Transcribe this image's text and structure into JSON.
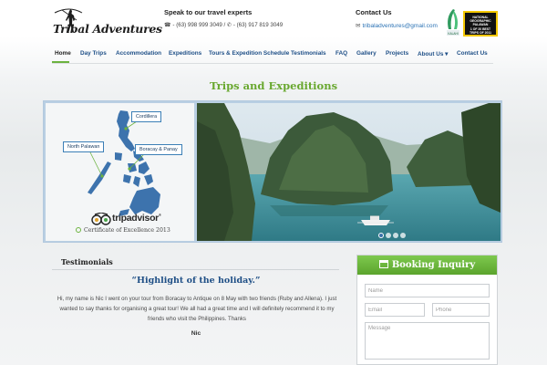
{
  "header": {
    "logo_text": "Tribal Adventures",
    "speak_title": "Speak to our travel experts",
    "phones": "☎ - (63) 998 999 3049 / ✆ - (63) 917 819 3049",
    "contact_title": "Contact Us",
    "email": "tribaladventures@gmail.com",
    "email_icon": "envelope-icon",
    "award_leaf_icon": "laurel-award-icon",
    "natgeo_badge": [
      "NATIONAL",
      "GEOGRAPHIC",
      "PALAWAN",
      "1 OF 20 BEST",
      "TRIPS OF 2011"
    ]
  },
  "nav": {
    "items": [
      {
        "label": "Home",
        "active": true
      },
      {
        "label": "Day Trips"
      },
      {
        "label": "Accommodation"
      },
      {
        "label": "Expeditions"
      },
      {
        "label": "Tours & Expedition Schedule"
      },
      {
        "label": "Testimonials"
      },
      {
        "label": "FAQ"
      },
      {
        "label": "Gallery"
      },
      {
        "label": "Projects"
      },
      {
        "label": "About Us ▾"
      },
      {
        "label": "Contact Us"
      }
    ]
  },
  "section_title": "Trips and Expeditions",
  "hero": {
    "map_labels": {
      "cordillera": "Cordillera",
      "north_palawan": "North Palawan",
      "boracay": "Boracay & Panay"
    },
    "tripadvisor_text": "tripadvisor",
    "certificate": "Certificate of Excellence 2013",
    "slider_dots": 4,
    "active_slide": 1
  },
  "testimonials": {
    "heading": "Testimonials",
    "quote": "“Highlight of the holiday.”",
    "body": "Hi, my name is Nic I went on your tour from Boracay to Antique on 8 May with two friends (Ruby and Allena). I just wanted to say thanks for organising a great tour! We all had a great time and I will definitely recommend it to my friends who visit the Philippines. Thanks",
    "author": "Nic"
  },
  "booking": {
    "title": "Booking Inquiry",
    "title_icon": "calendar-icon",
    "name_placeholder": "Name",
    "email_placeholder": "Email",
    "phone_placeholder": "Phone",
    "message_placeholder": "Message"
  },
  "colors": {
    "accent_green": "#6cb33f",
    "nav_blue": "#1e4f87",
    "link_blue": "#2c73b5"
  }
}
